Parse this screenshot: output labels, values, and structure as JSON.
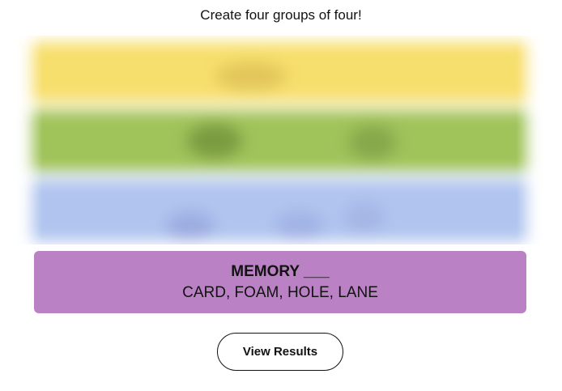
{
  "instructions": "Create four groups of four!",
  "colors": {
    "yellow": "#f7df6d",
    "green": "#a0c35a",
    "blue": "#b0c4ef",
    "purple": "#ba81c5"
  },
  "blurred_rows": [
    {
      "color_key": "yellow",
      "state": "blurred"
    },
    {
      "color_key": "green",
      "state": "blurred"
    },
    {
      "color_key": "blue",
      "state": "blurred"
    }
  ],
  "solved_group": {
    "title": "MEMORY ___",
    "members": "CARD, FOAM, HOLE, LANE",
    "color": "#ba81c5"
  },
  "results_button": {
    "label": "View Results"
  }
}
